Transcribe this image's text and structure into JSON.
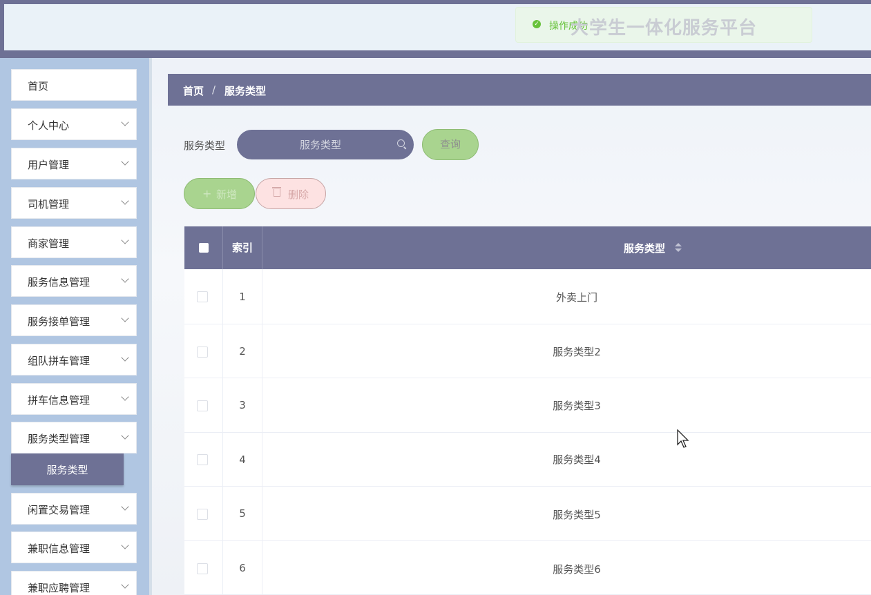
{
  "header": {
    "site_title": "大学生一体化服务平台",
    "toast_text": "操作成功",
    "toast_icon": "check-circle-icon",
    "accent_color": "#6e7195"
  },
  "sidebar": {
    "items": [
      {
        "label": "首页",
        "has_chevron": false
      },
      {
        "label": "个人中心",
        "has_chevron": true
      },
      {
        "label": "用户管理",
        "has_chevron": true
      },
      {
        "label": "司机管理",
        "has_chevron": true
      },
      {
        "label": "商家管理",
        "has_chevron": true
      },
      {
        "label": "服务信息管理",
        "has_chevron": true
      },
      {
        "label": "服务接单管理",
        "has_chevron": true
      },
      {
        "label": "组队拼车管理",
        "has_chevron": true
      },
      {
        "label": "拼车信息管理",
        "has_chevron": true
      },
      {
        "label": "服务类型管理",
        "has_chevron": true
      },
      {
        "label": "闲置交易管理",
        "has_chevron": true
      },
      {
        "label": "兼职信息管理",
        "has_chevron": true
      },
      {
        "label": "兼职应聘管理",
        "has_chevron": true
      }
    ],
    "active_submenu": "服务类型"
  },
  "breadcrumb": {
    "home": "首页",
    "separator": "/",
    "current": "服务类型"
  },
  "search": {
    "label": "服务类型",
    "placeholder": "服务类型",
    "query_button": "查询"
  },
  "actions": {
    "add_label": "新增",
    "delete_label": "删除"
  },
  "table": {
    "columns": [
      "索引",
      "服务类型"
    ],
    "rows": [
      {
        "index": "1",
        "type": "外卖上门"
      },
      {
        "index": "2",
        "type": "服务类型2"
      },
      {
        "index": "3",
        "type": "服务类型3"
      },
      {
        "index": "4",
        "type": "服务类型4"
      },
      {
        "index": "5",
        "type": "服务类型5"
      },
      {
        "index": "6",
        "type": "服务类型6"
      }
    ]
  }
}
